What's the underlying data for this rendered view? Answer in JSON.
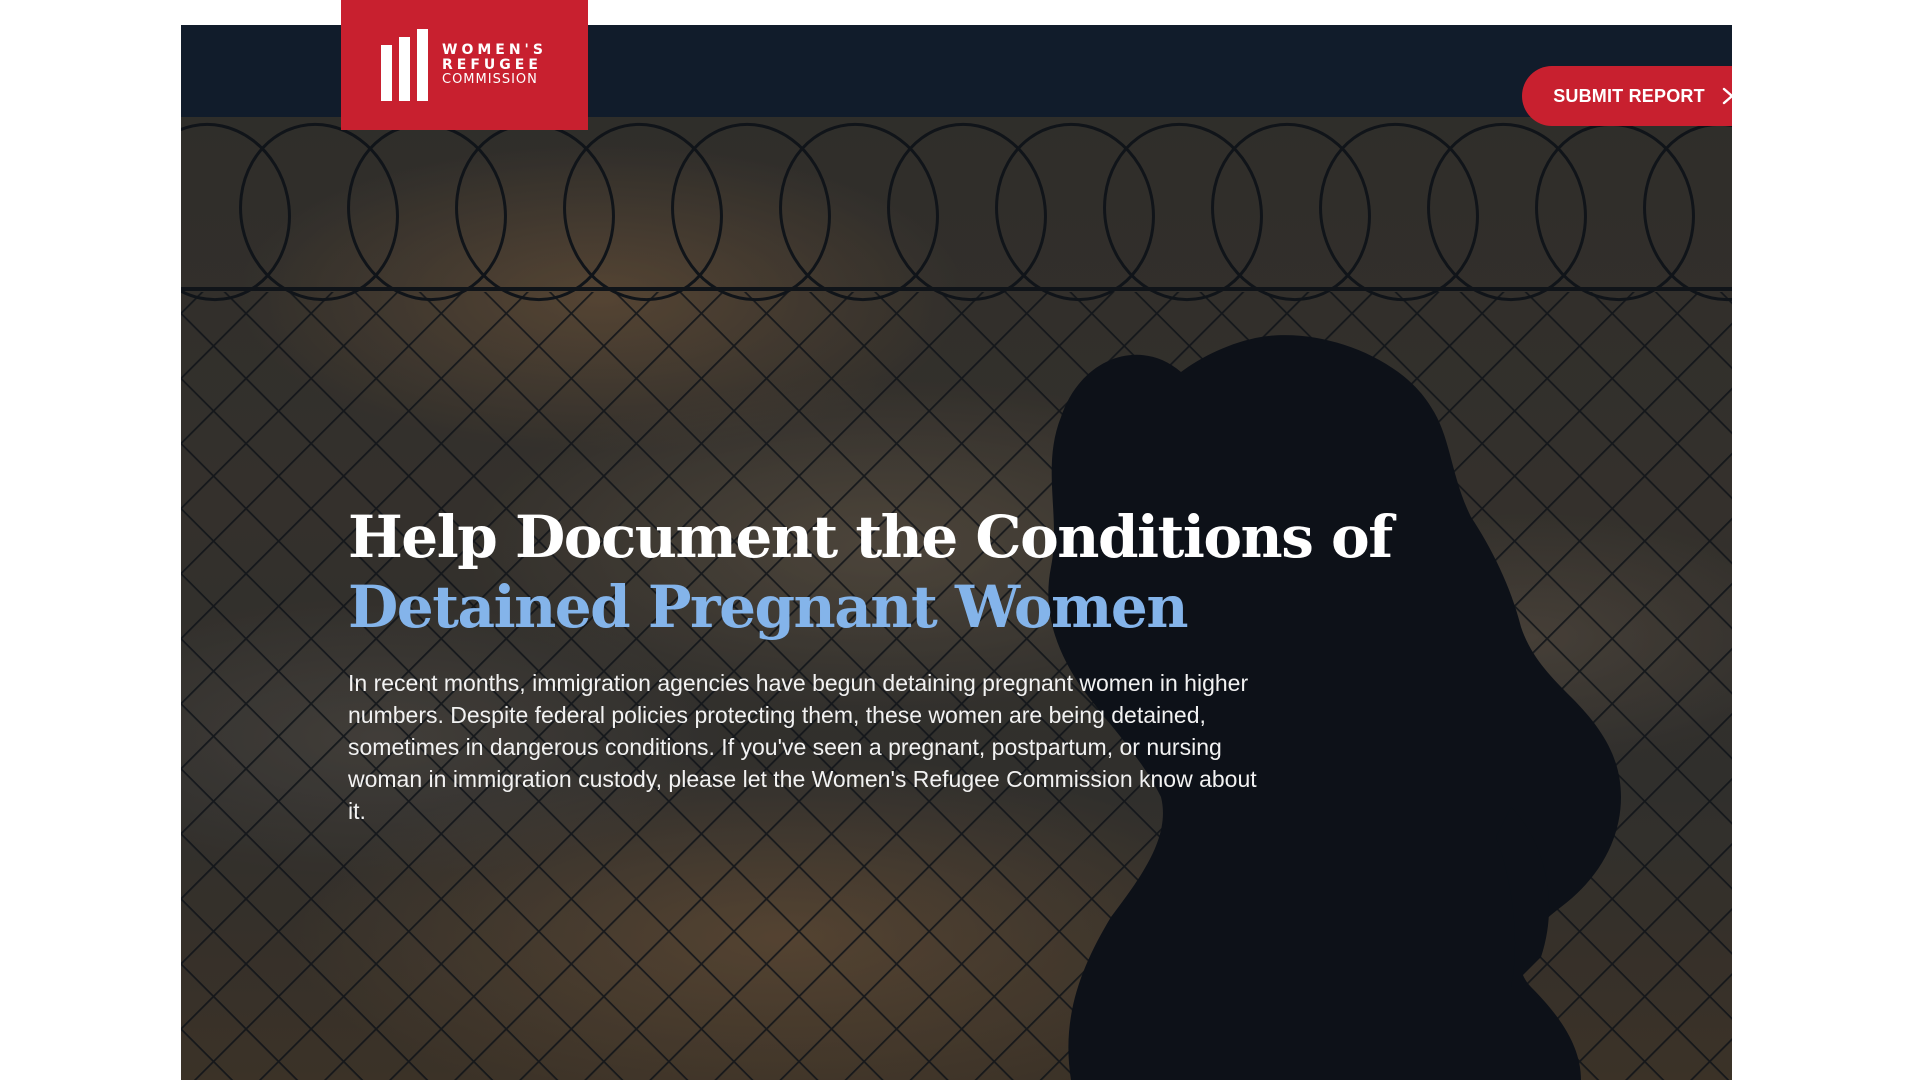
{
  "brand": {
    "logo_line1": "WOMEN'S",
    "logo_line2": "REFUGEE",
    "logo_line3": "COMMISSION",
    "color": "#c8202f"
  },
  "header": {
    "submit_label": "SUBMIT REPORT",
    "submit_icon": "chevron-right-icon",
    "background": "#111c2b"
  },
  "hero": {
    "headline_line1": "Help Document the Conditions of",
    "headline_line2": "Detained Pregnant Women",
    "accent_color": "#84b4ea",
    "body": "In recent months, immigration agencies have begun detaining pregnant women in higher numbers. Despite federal policies protecting them, these women are being detained, sometimes in dangerous conditions. If you've seen a pregnant, postpartum, or nursing woman in immigration custody, please let the Women's Refugee Commission know about it."
  }
}
